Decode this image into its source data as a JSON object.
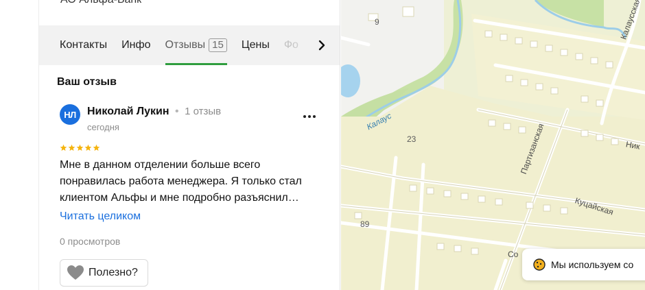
{
  "org": {
    "name": "АО Альфа-Банк"
  },
  "tabs": [
    {
      "label": "Контакты"
    },
    {
      "label": "Инфо"
    },
    {
      "label": "Отзывы",
      "count": "15"
    },
    {
      "label": "Цены"
    },
    {
      "label": "Фо"
    }
  ],
  "active_tab_color": "#2f9d3e",
  "review_section": {
    "title": "Ваш отзыв",
    "author": {
      "initials": "НЛ",
      "name": "Николай Лукин",
      "separator": "•",
      "reviews_count": "1 отзыв",
      "date": "сегодня",
      "avatar_color": "#1a6fde"
    },
    "rating": 5,
    "rating_max": 5,
    "star_color": "#f5b40f",
    "text_lines": [
      "Мне в данном отделении больше всего",
      "понравилась работа менеджера. Я только стал",
      "клиентом Альфы и мне подробно разъяснил…"
    ],
    "read_more": "Читать целиком",
    "views": "0 просмотров",
    "useful_button": "Полезно?"
  },
  "map": {
    "labels": {
      "house_9": "9",
      "house_23": "23",
      "house_89": "89",
      "river": "Калаус",
      "street_kalausskaya": "Калаусская",
      "street_partizanskaya": "Партизанская",
      "street_kutsayskaya": "Куцайская",
      "street_nik": "Ник",
      "street_so": "Со"
    }
  },
  "cookie_notice": {
    "text": "Мы используем со"
  }
}
